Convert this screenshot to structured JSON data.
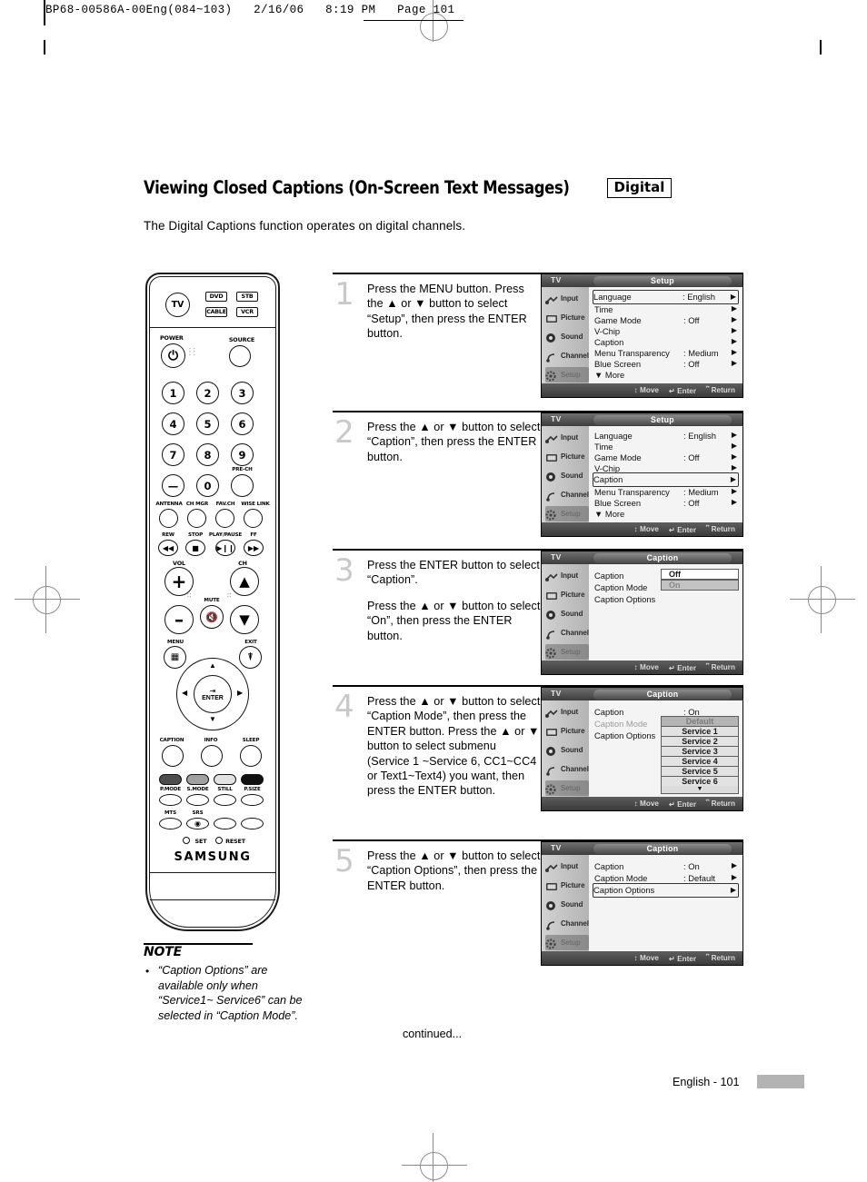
{
  "print_header": {
    "text": "BP68-00586A-00Eng(084~103)   2/16/06   8:19 PM   Page 101"
  },
  "page": {
    "title": "Viewing Closed Captions (On-Screen Text Messages)",
    "badge": "Digital",
    "subtitle": "The Digital Captions function operates on digital channels.",
    "continued": "continued...",
    "page_label": "English - 101"
  },
  "note": {
    "heading": "NOTE",
    "bullet": "•",
    "text": "“Caption Options” are available only when “Service1~ Service6” can be selected in “Caption Mode”."
  },
  "steps": [
    {
      "number": "1",
      "paragraphs": [
        "Press the MENU button. Press the ▲ or ▼ button to select “Setup”, then press the ENTER button."
      ]
    },
    {
      "number": "2",
      "paragraphs": [
        "Press the ▲ or ▼ button to select “Caption”, then press the ENTER button."
      ]
    },
    {
      "number": "3",
      "paragraphs": [
        "Press the ENTER button to select “Caption”.",
        "Press the ▲ or ▼ button to select “On”, then press the ENTER button."
      ]
    },
    {
      "number": "4",
      "paragraphs": [
        "Press the ▲ or ▼ button to select “Caption Mode”, then press the ENTER button. Press the ▲ or ▼ button to select submenu (Service 1 ~Service 6, CC1~CC4 or Text1~Text4) you want, then press the ENTER button."
      ]
    },
    {
      "number": "5",
      "paragraphs": [
        "Press the ▲ or ▼ button to select “Caption Options”, then press the ENTER button."
      ]
    }
  ],
  "osd": {
    "source_label": "TV",
    "sidebar": [
      {
        "label": "Input",
        "icon": "input-icon"
      },
      {
        "label": "Picture",
        "icon": "picture-icon"
      },
      {
        "label": "Sound",
        "icon": "sound-icon"
      },
      {
        "label": "Channel",
        "icon": "channel-icon"
      },
      {
        "label": "Setup",
        "icon": "setup-icon"
      }
    ],
    "footer": [
      {
        "glyph": "↕",
        "label": "Move"
      },
      {
        "glyph": "↵",
        "label": "Enter"
      },
      {
        "glyph": "⌸",
        "label": "Return"
      }
    ],
    "screens": [
      {
        "title": "Setup",
        "rows": [
          {
            "name": "Language",
            "value": ": English",
            "arrow": "▶",
            "boxed": true
          },
          {
            "name": "Time",
            "value": "",
            "arrow": "▶",
            "boxed": false
          },
          {
            "name": "Game Mode",
            "value": ": Off",
            "arrow": "▶",
            "boxed": false
          },
          {
            "name": "V-Chip",
            "value": "",
            "arrow": "▶",
            "boxed": false
          },
          {
            "name": "Caption",
            "value": "",
            "arrow": "▶",
            "boxed": false
          },
          {
            "name": "Menu Transparency",
            "value": ": Medium",
            "arrow": "▶",
            "boxed": false
          },
          {
            "name": "Blue Screen",
            "value": ": Off",
            "arrow": "▶",
            "boxed": false
          }
        ],
        "more": "▼ More"
      },
      {
        "title": "Setup",
        "rows": [
          {
            "name": "Language",
            "value": ": English",
            "arrow": "▶",
            "boxed": false
          },
          {
            "name": "Time",
            "value": "",
            "arrow": "▶",
            "boxed": false
          },
          {
            "name": "Game Mode",
            "value": ": Off",
            "arrow": "▶",
            "boxed": false
          },
          {
            "name": "V-Chip",
            "value": "",
            "arrow": "▶",
            "boxed": false
          },
          {
            "name": "Caption",
            "value": "",
            "arrow": "▶",
            "boxed": true
          },
          {
            "name": "Menu Transparency",
            "value": ": Medium",
            "arrow": "▶",
            "boxed": false
          },
          {
            "name": "Blue Screen",
            "value": ": Off",
            "arrow": "▶",
            "boxed": false
          }
        ],
        "more": "▼ More"
      },
      {
        "title": "Caption",
        "rows": [
          {
            "name": "Caption",
            "value": "",
            "arrow": "",
            "boxed": false
          },
          {
            "name": "Caption Mode",
            "value": "",
            "arrow": "",
            "boxed": false
          },
          {
            "name": "Caption Options",
            "value": "",
            "arrow": "",
            "boxed": false
          }
        ],
        "options": [
          {
            "label": "Off",
            "state": "white"
          },
          {
            "label": "On",
            "state": "gray"
          }
        ]
      },
      {
        "title": "Caption",
        "rows": [
          {
            "name": "Caption",
            "value": ": On",
            "arrow": "",
            "boxed": false
          },
          {
            "name": "Caption Mode",
            "value": "",
            "arrow": "",
            "boxed": false,
            "dim": true
          },
          {
            "name": "Caption Options",
            "value": "",
            "arrow": "",
            "boxed": false
          }
        ],
        "options": [
          {
            "label": "Default",
            "state": "listsel"
          },
          {
            "label": "Service 1",
            "state": "list"
          },
          {
            "label": "Service 2",
            "state": "list"
          },
          {
            "label": "Service 3",
            "state": "list"
          },
          {
            "label": "Service 4",
            "state": "list"
          },
          {
            "label": "Service 5",
            "state": "list"
          },
          {
            "label": "Service 6",
            "state": "list"
          }
        ],
        "options_more": "▼"
      },
      {
        "title": "Caption",
        "rows": [
          {
            "name": "Caption",
            "value": ": On",
            "arrow": "▶",
            "boxed": false
          },
          {
            "name": "Caption Mode",
            "value": ": Default",
            "arrow": "▶",
            "boxed": false
          },
          {
            "name": "Caption Options",
            "value": "",
            "arrow": "▶",
            "boxed": true
          }
        ]
      }
    ]
  },
  "remote": {
    "brand": "SAMSUNG",
    "mode_buttons": [
      {
        "label": "TV",
        "shape": "circle"
      },
      {
        "label": "DVD",
        "shape": "rect"
      },
      {
        "label": "STB",
        "shape": "rect"
      },
      {
        "label": "CABLE",
        "shape": "rect"
      },
      {
        "label": "VCR",
        "shape": "rect"
      }
    ],
    "power_label": "POWER",
    "source_label": "SOURCE",
    "numbers": [
      "1",
      "2",
      "3",
      "4",
      "5",
      "6",
      "7",
      "8",
      "9"
    ],
    "dash_label": "—",
    "zero_label": "0",
    "prech_label": "PRE-CH",
    "fn_row": [
      "ANTENNA",
      "CH MGR",
      "FAV.CH",
      "WISE LINK"
    ],
    "transport": [
      "REW",
      "STOP",
      "PLAY/PAUSE",
      "FF"
    ],
    "vol_label": "VOL",
    "ch_label": "CH",
    "mute_label": "MUTE",
    "menu_label": "MENU",
    "exit_label": "EXIT",
    "enter_label": "ENTER",
    "caption_label": "CAPTION",
    "info_label": "INFO",
    "sleep_label": "SLEEP",
    "mode_row": [
      "P.MODE",
      "S.MODE",
      "STILL",
      "P.SIZE"
    ],
    "audio_row": [
      "MTS",
      "SRS"
    ],
    "set_label": "SET",
    "reset_label": "RESET"
  }
}
